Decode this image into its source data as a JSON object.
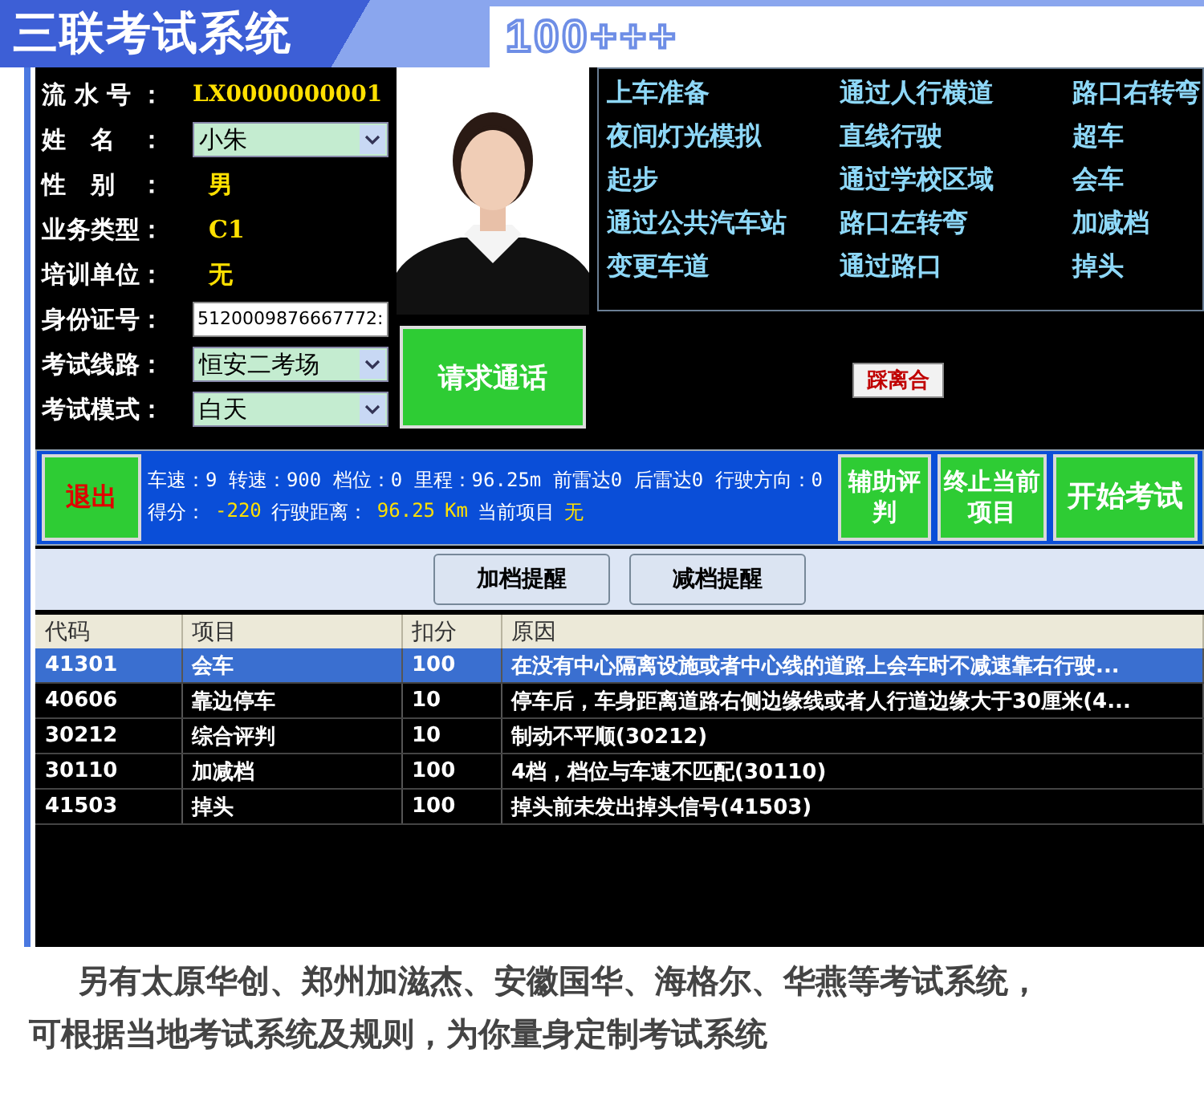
{
  "header": {
    "title": "三联考试系统",
    "badge": "100+++"
  },
  "info_fields": [
    {
      "kind": "text",
      "label": "流水号：",
      "value": "LX0000000001"
    },
    {
      "kind": "combo",
      "label": "姓名：",
      "value": "小朱"
    },
    {
      "kind": "text",
      "label": "性别：",
      "value": "男"
    },
    {
      "kind": "text",
      "label": "业务类型：",
      "value": "C1"
    },
    {
      "kind": "text",
      "label": "培训单位：",
      "value": "无"
    },
    {
      "kind": "input",
      "label": "身份证号：",
      "value": "5120009876667772:"
    },
    {
      "kind": "combo",
      "label": "考试线路：",
      "value": "恒安二考场"
    },
    {
      "kind": "combo",
      "label": "考试模式：",
      "value": "白天"
    }
  ],
  "photo": {
    "kind": "picture"
  },
  "call_button": "请求通话",
  "exam_items": [
    "上车准备",
    "通过人行横道",
    "路口右转弯",
    "夜间灯光模拟",
    "直线行驶",
    "超车",
    "起步",
    "通过学校区域",
    "会车",
    "通过公共汽车站",
    "路口左转弯",
    "加减档",
    "变更车道",
    "通过路口",
    "掉头"
  ],
  "clutch_indicator": "踩离合",
  "status_bar": {
    "exit_button": "退出",
    "readings": "车速：9 转速：900 档位：0 里程：96.25m 前雷达0 后雷达0 行驶方向：0",
    "summary": [
      {
        "label": "得分：",
        "value": "-220"
      },
      {
        "label": "行驶距离：",
        "value": "96.25"
      },
      {
        "value": "Km"
      },
      {
        "label": "当前项目",
        "value": "无"
      }
    ],
    "buttons": [
      "辅助评判",
      "终止当前项目",
      "开始考试"
    ]
  },
  "remind_buttons": [
    "加档提醒",
    "减档提醒"
  ],
  "table": {
    "columns": [
      "代码",
      "项目",
      "扣分",
      "原因"
    ],
    "rows": [
      {
        "selected": true,
        "cells": [
          "41301",
          "会车",
          "100",
          "在没有中心隔离设施或者中心线的道路上会车时不减速靠右行驶..."
        ]
      },
      {
        "selected": false,
        "cells": [
          "40606",
          "靠边停车",
          "10",
          "停车后，车身距离道路右侧边缘线或者人行道边缘大于30厘米(4..."
        ]
      },
      {
        "selected": false,
        "cells": [
          "30212",
          "综合评判",
          "10",
          "制动不平顺(30212)"
        ]
      },
      {
        "selected": false,
        "cells": [
          "30110",
          "加减档",
          "100",
          "4档，档位与车速不匹配(30110)"
        ]
      },
      {
        "selected": false,
        "cells": [
          "41503",
          "掉头",
          "100",
          "掉头前未发出掉头信号(41503)"
        ]
      }
    ]
  },
  "caption": [
    "另有太原华创、郑州加滋杰、安徽国华、海格尔、华燕等考试系统，",
    "可根据当地考试系统及规则，为你量身定制考试系统"
  ]
}
